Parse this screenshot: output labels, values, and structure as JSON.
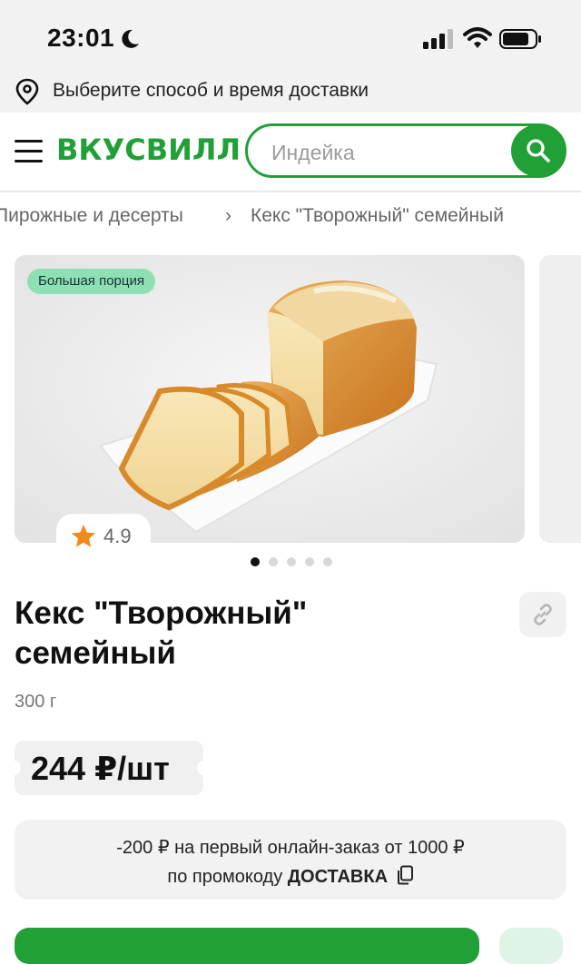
{
  "status_bar": {
    "time": "23:01"
  },
  "delivery": {
    "text": "Выберите способ и время доставки"
  },
  "header": {
    "logo": "ВКУСВИЛЛ",
    "search_placeholder": "Индейка"
  },
  "breadcrumbs": {
    "category": "Пирожные и десерты",
    "separator": "›",
    "current": "Кекс \"Творожный\" семейный"
  },
  "gallery": {
    "badge": "Большая порция",
    "rating": "4.9",
    "slide_count": 5,
    "active_slide": 1
  },
  "product": {
    "title": "Кекс \"Творожный\" семейный",
    "weight": "300 г",
    "price": "244 ₽/шт"
  },
  "promo": {
    "line1": "-200 ₽ на первый онлайн-заказ от 1000 ₽",
    "line2_prefix": "по промокоду ",
    "code": "ДОСТАВКА"
  },
  "colors": {
    "brand_green": "#21a038",
    "badge_green": "#8ee0b4",
    "star_orange": "#f08a1c"
  }
}
